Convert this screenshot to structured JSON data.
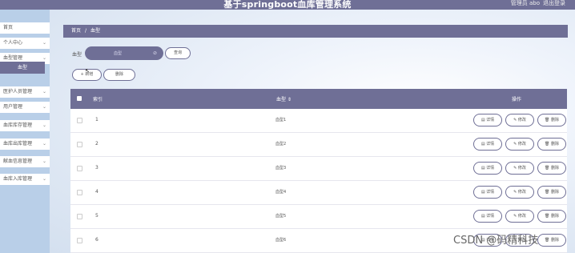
{
  "header": {
    "title": "基于springboot血库管理系统",
    "user": "管理员 abo",
    "logout": "退出登录"
  },
  "sidebar": {
    "items": [
      {
        "label": "首页",
        "has_arrow": false
      },
      {
        "label": "个人中心",
        "has_arrow": true
      },
      {
        "label": "血型管理",
        "has_arrow": true
      },
      {
        "label": "医护人员管理",
        "has_arrow": true
      },
      {
        "label": "用户管理",
        "has_arrow": true
      },
      {
        "label": "血库库存管理",
        "has_arrow": true
      },
      {
        "label": "血库出库管理",
        "has_arrow": true
      },
      {
        "label": "献血信息管理",
        "has_arrow": true
      },
      {
        "label": "血库入库管理",
        "has_arrow": true
      }
    ],
    "active_sub": "血型"
  },
  "breadcrumb": {
    "home": "首页",
    "sep": "/",
    "current": "血型"
  },
  "search": {
    "label": "血型",
    "placeholder": "血型",
    "clear_icon": "⊘",
    "search_button": "查询"
  },
  "actions": {
    "add": "+ 新增",
    "delete": "删除"
  },
  "table": {
    "headers": {
      "index": "索引",
      "name": "血型 ⇕",
      "ops": "操作"
    },
    "rows": [
      {
        "index": "1",
        "name": "血型1"
      },
      {
        "index": "2",
        "name": "血型2"
      },
      {
        "index": "3",
        "name": "血型3"
      },
      {
        "index": "4",
        "name": "血型4"
      },
      {
        "index": "5",
        "name": "血型5"
      },
      {
        "index": "6",
        "name": "血型6"
      }
    ],
    "op_labels": {
      "detail": "详情",
      "edit": "修改",
      "delete": "删除"
    }
  },
  "watermark": "CSDN @码精科技",
  "colors": {
    "primary": "#6f6f96",
    "sidebar": "#b9cfe8"
  }
}
